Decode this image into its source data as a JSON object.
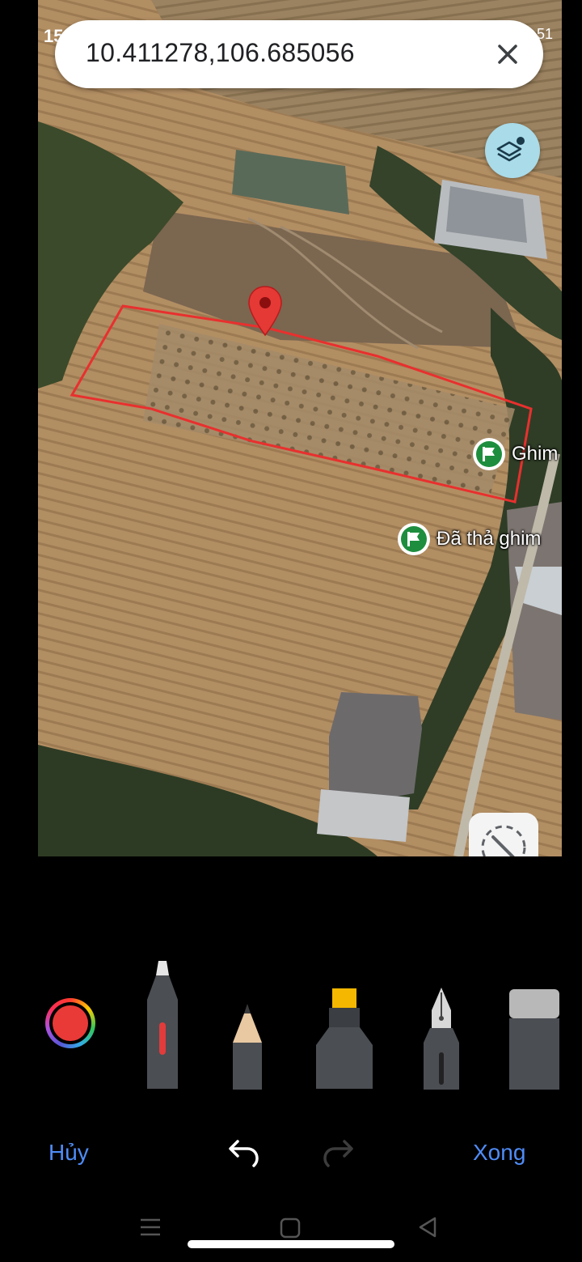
{
  "status_bar": {
    "time_partial": "15",
    "battery_partial": "51"
  },
  "search": {
    "query": "10.411278,106.685056"
  },
  "map": {
    "pins": [
      {
        "label": "Ghim"
      },
      {
        "label": "Đã thả ghim"
      }
    ],
    "outline_color": "#e8302e"
  },
  "toolbar": {
    "selected_color": "#e93a37",
    "tools": [
      "pen",
      "pencil",
      "highlighter",
      "fountain-pen",
      "eraser"
    ]
  },
  "actions": {
    "cancel_label": "Hủy",
    "done_label": "Xong"
  },
  "accent_color": "#4f8cf7"
}
